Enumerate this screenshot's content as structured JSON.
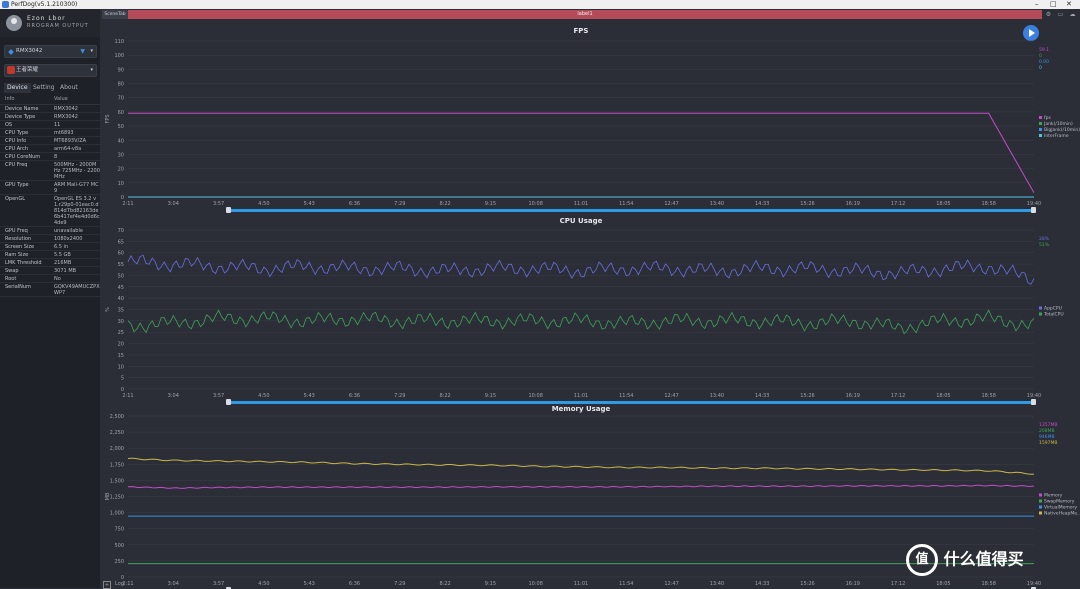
{
  "window": {
    "title": "PerfDog(v5.1.210300)",
    "min": "–",
    "max": "□",
    "close": "✕"
  },
  "user": {
    "name": "Ezon Lbor",
    "sub": "RROGRAM OUTPUT"
  },
  "device_select": {
    "value": "RMX3042"
  },
  "app_select": {
    "value": "王者荣耀"
  },
  "tabs": [
    {
      "label": "Device"
    },
    {
      "label": "Setting"
    },
    {
      "label": "About"
    }
  ],
  "info": {
    "header_key": "Info",
    "header_value": "Value",
    "rows": [
      {
        "k": "Device Name",
        "v": "RMX3042"
      },
      {
        "k": "Device Type",
        "v": "RMX3042"
      },
      {
        "k": "OS",
        "v": "11"
      },
      {
        "k": "CPU Type",
        "v": "mt6893"
      },
      {
        "k": "CPU Info",
        "v": "MT6893V/ZA"
      },
      {
        "k": "CPU Arch",
        "v": "arm64-v8a"
      },
      {
        "k": "CPU CoreNum",
        "v": "8"
      },
      {
        "k": "CPU Freq",
        "v": "500MHz - 2000MHz 725MHz - 2200MHz"
      },
      {
        "k": "GPU Type",
        "v": "ARM Mali-G77 MC9"
      },
      {
        "k": "OpenGL",
        "v": "OpenGL ES 3.2 v1.r29p0-01eac0.d814d7bd82163de6b417ef4e4d0d6c4de9"
      },
      {
        "k": "GPU Freq",
        "v": "unavailable"
      },
      {
        "k": "Resolution",
        "v": "1080x2400"
      },
      {
        "k": "Screen Size",
        "v": "6.5 in"
      },
      {
        "k": "Ram Size",
        "v": "5.5 GB"
      },
      {
        "k": "LMK Threshold",
        "v": "216MB"
      },
      {
        "k": "Swap",
        "v": "3071 MB"
      },
      {
        "k": "Root",
        "v": "No"
      },
      {
        "k": "SerialNum",
        "v": "GQKV49AMUCZPXWP7"
      }
    ]
  },
  "scene": {
    "tab": "SceneTab",
    "label": "label1"
  },
  "footer": {
    "add": "+",
    "log": "Log"
  },
  "watermark": {
    "symbol": "值",
    "text": "什么值得买"
  },
  "colors": {
    "fps": "#c44cc8",
    "cpu_app": "#6a6fe0",
    "cpu_total": "#3fa35a",
    "mem": "#c44cc8",
    "mem_swap": "#3fa35a",
    "mem_virtual": "#3b8fe5",
    "mem_native": "#c9b84a",
    "accent": "#3b7fe0",
    "label_bar": "#b54a5a"
  },
  "time_ticks": [
    "2:11",
    "3:04",
    "3:57",
    "4:50",
    "5:43",
    "6:36",
    "7:29",
    "8:22",
    "9:15",
    "10:08",
    "11:01",
    "11:54",
    "12:47",
    "13:40",
    "14:33",
    "15:26",
    "16:19",
    "17:12",
    "18:05",
    "18:58",
    "19:40"
  ],
  "chart_data": [
    {
      "type": "line",
      "title": "FPS",
      "ylabel": "FPS",
      "ylim": [
        0,
        110
      ],
      "yticks": [
        "0",
        "10",
        "20",
        "30",
        "40",
        "50",
        "60",
        "70",
        "80",
        "90",
        "100",
        "110"
      ],
      "x": [
        "2:11",
        "3:04",
        "3:57",
        "4:50",
        "5:43",
        "6:36",
        "7:29",
        "8:22",
        "9:15",
        "10:08",
        "11:01",
        "11:54",
        "12:47",
        "13:40",
        "14:33",
        "15:26",
        "16:19",
        "17:12",
        "18:05",
        "18:58",
        "19:40"
      ],
      "series": [
        {
          "name": "fps",
          "values": [
            59,
            59,
            59,
            59,
            59,
            59,
            59,
            59,
            59,
            59,
            59,
            59,
            59,
            59,
            59,
            59,
            59,
            59,
            59,
            59,
            3
          ],
          "color": "#c44cc8"
        },
        {
          "name": "Jank(/10min)",
          "values": [
            0,
            0,
            0,
            0,
            0,
            0,
            0,
            0,
            0,
            0,
            0,
            0,
            0,
            0,
            0,
            0,
            0,
            0,
            0,
            0,
            0
          ],
          "color": "#3fa35a"
        },
        {
          "name": "BigJank(/10min)",
          "values": [
            0,
            0,
            0,
            0,
            0,
            0,
            0,
            0,
            0,
            0,
            0,
            0,
            0,
            0,
            0,
            0,
            0,
            0,
            0,
            0,
            0
          ],
          "color": "#3b8fe5"
        },
        {
          "name": "InterFrame",
          "values": [
            0,
            0,
            0,
            0,
            0,
            0,
            0,
            0,
            0,
            0,
            0,
            0,
            0,
            0,
            0,
            0,
            0,
            0,
            0,
            0,
            0
          ],
          "color": "#4fc3e0"
        }
      ],
      "current": [
        "59.1",
        "0",
        "0.00",
        "0"
      ],
      "legend_position": "right"
    },
    {
      "type": "line",
      "title": "CPU Usage",
      "ylabel": "%",
      "ylim": [
        0,
        70
      ],
      "yticks": [
        "0",
        "5",
        "10",
        "15",
        "20",
        "25",
        "30",
        "35",
        "40",
        "45",
        "50",
        "55",
        "60",
        "65",
        "70"
      ],
      "x": [
        "2:11",
        "3:04",
        "3:57",
        "4:50",
        "5:43",
        "6:36",
        "7:29",
        "8:22",
        "9:15",
        "10:08",
        "11:01",
        "11:54",
        "12:47",
        "13:40",
        "14:33",
        "15:26",
        "16:19",
        "17:12",
        "18:05",
        "18:58",
        "19:40"
      ],
      "series": [
        {
          "name": "AppCPU",
          "values": [
            56,
            55,
            54,
            53,
            54,
            53,
            53,
            52,
            53,
            53,
            52,
            53,
            53,
            52,
            53,
            53,
            52,
            51,
            53,
            54,
            48
          ],
          "color": "#6a6fe0"
        },
        {
          "name": "TotalCPU",
          "values": [
            28,
            29,
            31,
            31,
            30,
            31,
            30,
            30,
            30,
            30,
            30,
            29,
            30,
            30,
            30,
            29,
            30,
            27,
            30,
            31,
            28
          ],
          "color": "#3fa35a"
        }
      ],
      "current": [
        "28%",
        "51%"
      ],
      "legend_position": "right"
    },
    {
      "type": "line",
      "title": "Memory Usage",
      "ylabel": "MB",
      "ylim": [
        0,
        2500
      ],
      "yticks": [
        "0",
        "250",
        "500",
        "750",
        "1,000",
        "1,250",
        "1,500",
        "1,750",
        "2,000",
        "2,250",
        "2,500"
      ],
      "x": [
        "2:11",
        "3:04",
        "3:57",
        "4:50",
        "5:43",
        "6:36",
        "7:29",
        "8:22",
        "9:15",
        "10:08",
        "11:01",
        "11:54",
        "12:47",
        "13:40",
        "14:33",
        "15:26",
        "16:19",
        "17:12",
        "18:05",
        "18:58",
        "19:40"
      ],
      "series": [
        {
          "name": "Memory",
          "values": [
            1400,
            1380,
            1390,
            1395,
            1395,
            1395,
            1395,
            1395,
            1400,
            1400,
            1400,
            1400,
            1405,
            1410,
            1410,
            1410,
            1415,
            1415,
            1415,
            1420,
            1410
          ],
          "color": "#c44cc8"
        },
        {
          "name": "SwapMemory",
          "values": [
            208,
            208,
            208,
            208,
            208,
            208,
            208,
            208,
            208,
            208,
            208,
            208,
            208,
            208,
            208,
            208,
            208,
            208,
            208,
            208,
            208
          ],
          "color": "#3fa35a"
        },
        {
          "name": "VirtualMemory",
          "values": [
            946,
            946,
            946,
            946,
            946,
            946,
            946,
            946,
            946,
            946,
            946,
            946,
            946,
            946,
            946,
            946,
            946,
            946,
            946,
            946,
            946
          ],
          "color": "#3b8fe5"
        },
        {
          "name": "NativeHeapMe...",
          "values": [
            1840,
            1810,
            1800,
            1790,
            1780,
            1760,
            1750,
            1740,
            1735,
            1720,
            1710,
            1700,
            1700,
            1690,
            1690,
            1680,
            1675,
            1665,
            1660,
            1650,
            1600
          ],
          "color": "#c9b84a"
        }
      ],
      "current": [
        "1357MB",
        "208MB",
        "946MB",
        "1597MB"
      ],
      "legend_position": "right"
    }
  ]
}
